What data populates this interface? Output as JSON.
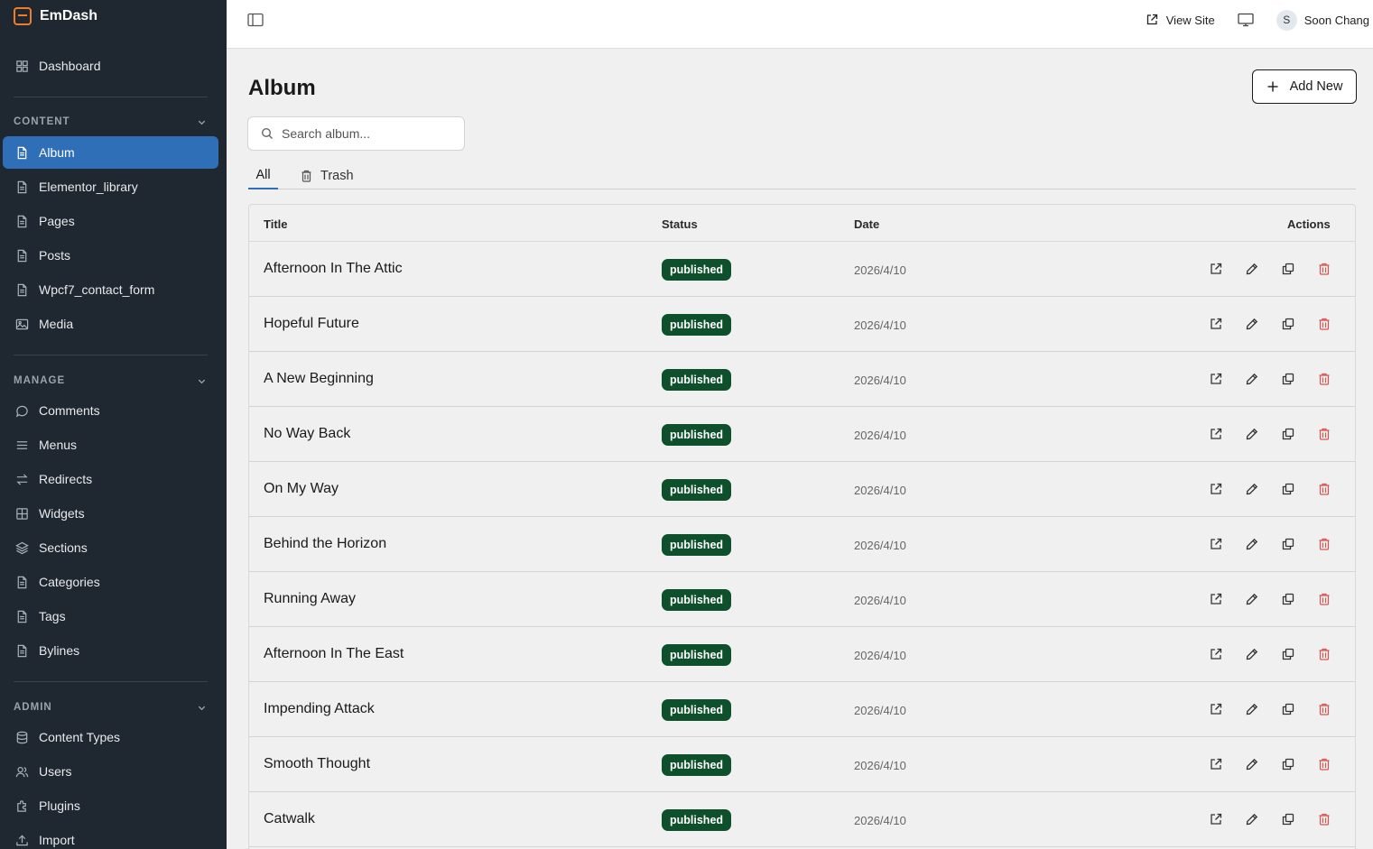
{
  "app": {
    "name": "EmDash"
  },
  "sidebar": {
    "dashboard": {
      "label": "Dashboard",
      "icon": "grid-icon"
    },
    "content_section": "CONTENT",
    "content_items": [
      {
        "label": "Album",
        "icon": "file-icon",
        "active": true
      },
      {
        "label": "Elementor_library",
        "icon": "file-icon"
      },
      {
        "label": "Pages",
        "icon": "file-icon"
      },
      {
        "label": "Posts",
        "icon": "file-icon"
      },
      {
        "label": "Wpcf7_contact_form",
        "icon": "file-icon"
      },
      {
        "label": "Media",
        "icon": "image-icon"
      }
    ],
    "manage_section": "MANAGE",
    "manage_items": [
      {
        "label": "Comments",
        "icon": "comment-icon"
      },
      {
        "label": "Menus",
        "icon": "menu-icon"
      },
      {
        "label": "Redirects",
        "icon": "redirect-icon"
      },
      {
        "label": "Widgets",
        "icon": "widgets-icon"
      },
      {
        "label": "Sections",
        "icon": "layers-icon"
      },
      {
        "label": "Categories",
        "icon": "file-icon"
      },
      {
        "label": "Tags",
        "icon": "file-icon"
      },
      {
        "label": "Bylines",
        "icon": "file-icon"
      }
    ],
    "admin_section": "ADMIN",
    "admin_items": [
      {
        "label": "Content Types",
        "icon": "database-icon"
      },
      {
        "label": "Users",
        "icon": "users-icon"
      },
      {
        "label": "Plugins",
        "icon": "plugin-icon"
      },
      {
        "label": "Import",
        "icon": "upload-icon"
      }
    ]
  },
  "topbar": {
    "view_site": "View Site",
    "user_initial": "S",
    "user_name": "Soon Chang"
  },
  "main": {
    "title": "Album",
    "add_new": "Add New",
    "search_placeholder": "Search album...",
    "tabs": [
      {
        "label": "All"
      },
      {
        "label": "Trash"
      }
    ],
    "columns": {
      "title": "Title",
      "status": "Status",
      "date": "Date",
      "actions": "Actions"
    },
    "rows": [
      {
        "title": "Afternoon In The Attic",
        "status": "published",
        "date": "2026/4/10"
      },
      {
        "title": "Hopeful Future",
        "status": "published",
        "date": "2026/4/10"
      },
      {
        "title": "A New Beginning",
        "status": "published",
        "date": "2026/4/10"
      },
      {
        "title": "No Way Back",
        "status": "published",
        "date": "2026/4/10"
      },
      {
        "title": "On My Way",
        "status": "published",
        "date": "2026/4/10"
      },
      {
        "title": "Behind the Horizon",
        "status": "published",
        "date": "2026/4/10"
      },
      {
        "title": "Running Away",
        "status": "published",
        "date": "2026/4/10"
      },
      {
        "title": "Afternoon In The East",
        "status": "published",
        "date": "2026/4/10"
      },
      {
        "title": "Impending Attack",
        "status": "published",
        "date": "2026/4/10"
      },
      {
        "title": "Smooth Thought",
        "status": "published",
        "date": "2026/4/10"
      },
      {
        "title": "Catwalk",
        "status": "published",
        "date": "2026/4/10"
      }
    ]
  },
  "colors": {
    "sidebar_bg": "#1f2730",
    "accent": "#2f6fb7",
    "badge": "#0e4f2c",
    "danger": "#d9534f",
    "brand": "#f07c2a"
  }
}
